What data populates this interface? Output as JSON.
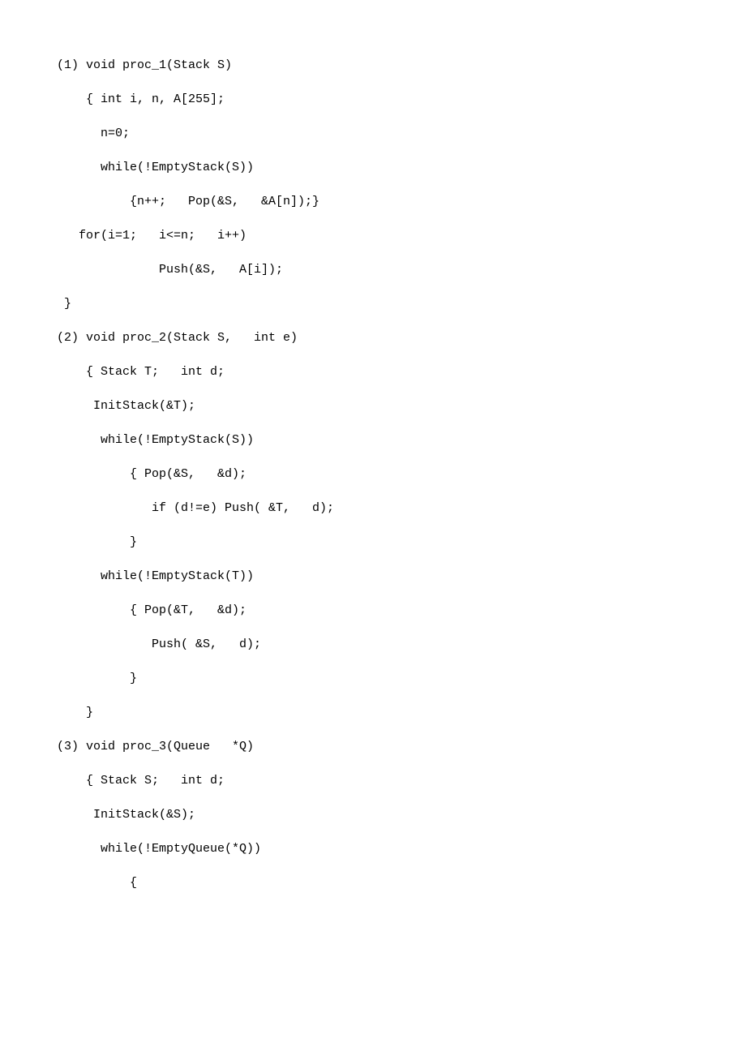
{
  "lines": [
    "(1) void proc_1(Stack S)",
    "    { int i, n, A[255];",
    "      n=0;",
    "      while(!EmptyStack(S))",
    "          {n++;   Pop(&S,   &A[n]);}",
    "   for(i=1;   i<=n;   i++)",
    "              Push(&S,   A[i]);",
    " }",
    "(2) void proc_2(Stack S,   int e)",
    "    { Stack T;   int d;",
    "     InitStack(&T);",
    "      while(!EmptyStack(S))",
    "          { Pop(&S,   &d);",
    "             if (d!=e) Push( &T,   d);",
    "          }",
    "      while(!EmptyStack(T))",
    "          { Pop(&T,   &d);",
    "             Push( &S,   d);",
    "          }",
    "    }",
    "(3) void proc_3(Queue   *Q)",
    "    { Stack S;   int d;",
    "     InitStack(&S);",
    "      while(!EmptyQueue(*Q))",
    "          {"
  ]
}
